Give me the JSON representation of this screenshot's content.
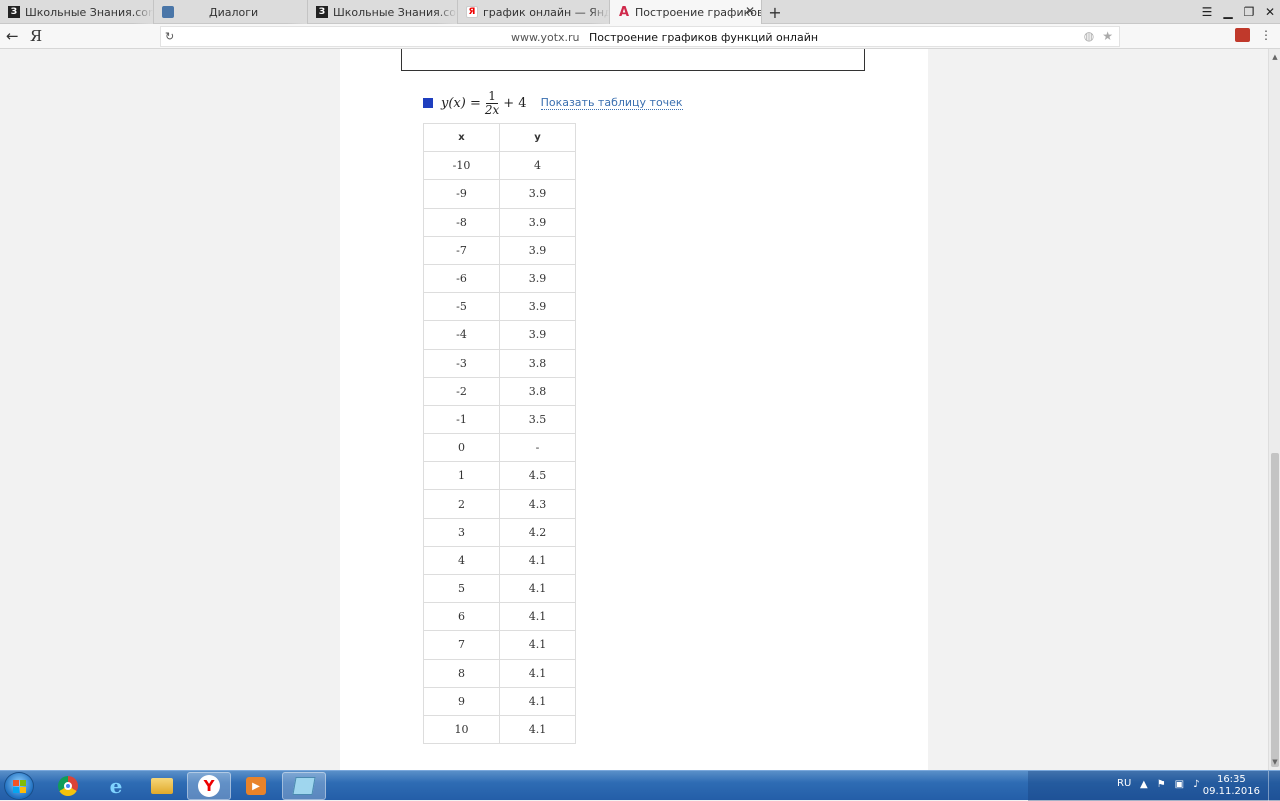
{
  "browser": {
    "tabs": [
      {
        "label": "Школьные Знания.com - Ре",
        "favicon": "znanija-icon",
        "glyph": "З",
        "width": 154,
        "active": false
      },
      {
        "label": "Диалоги",
        "favicon": "vk-icon",
        "glyph": "",
        "width": 154,
        "active": false
      },
      {
        "label": "Школьные Знания.com - Ре",
        "favicon": "znanija-icon",
        "glyph": "З",
        "width": 150,
        "active": false
      },
      {
        "label": "график онлайн — Яндекс: н",
        "favicon": "yandex-icon",
        "glyph": "Я",
        "width": 152,
        "active": false
      },
      {
        "label": "Построение графиков ф",
        "favicon": "yotx-icon",
        "glyph": "A",
        "width": 152,
        "active": true
      }
    ],
    "new_tab_glyph": "+",
    "close_glyph": "✕",
    "address": {
      "host": "www.yotx.ru",
      "title": "Построение графиков функций онлайн"
    }
  },
  "function": {
    "swatch_color": "#1f3fbf",
    "lhs": "y(x) =",
    "numerator": "1",
    "denominator": "2x",
    "rhs": "+ 4",
    "show_points_link": "Показать таблицу точек"
  },
  "points_table": {
    "headers": [
      "x",
      "y"
    ],
    "rows": [
      [
        "-10",
        "4"
      ],
      [
        "-9",
        "3.9"
      ],
      [
        "-8",
        "3.9"
      ],
      [
        "-7",
        "3.9"
      ],
      [
        "-6",
        "3.9"
      ],
      [
        "-5",
        "3.9"
      ],
      [
        "-4",
        "3.9"
      ],
      [
        "-3",
        "3.8"
      ],
      [
        "-2",
        "3.8"
      ],
      [
        "-1",
        "3.5"
      ],
      [
        "0",
        "-"
      ],
      [
        "1",
        "4.5"
      ],
      [
        "2",
        "4.3"
      ],
      [
        "3",
        "4.2"
      ],
      [
        "4",
        "4.1"
      ],
      [
        "5",
        "4.1"
      ],
      [
        "6",
        "4.1"
      ],
      [
        "7",
        "4.1"
      ],
      [
        "8",
        "4.1"
      ],
      [
        "9",
        "4.1"
      ],
      [
        "10",
        "4.1"
      ]
    ]
  },
  "taskbar": {
    "language": "RU",
    "time": "16:35",
    "date": "09.11.2016"
  }
}
